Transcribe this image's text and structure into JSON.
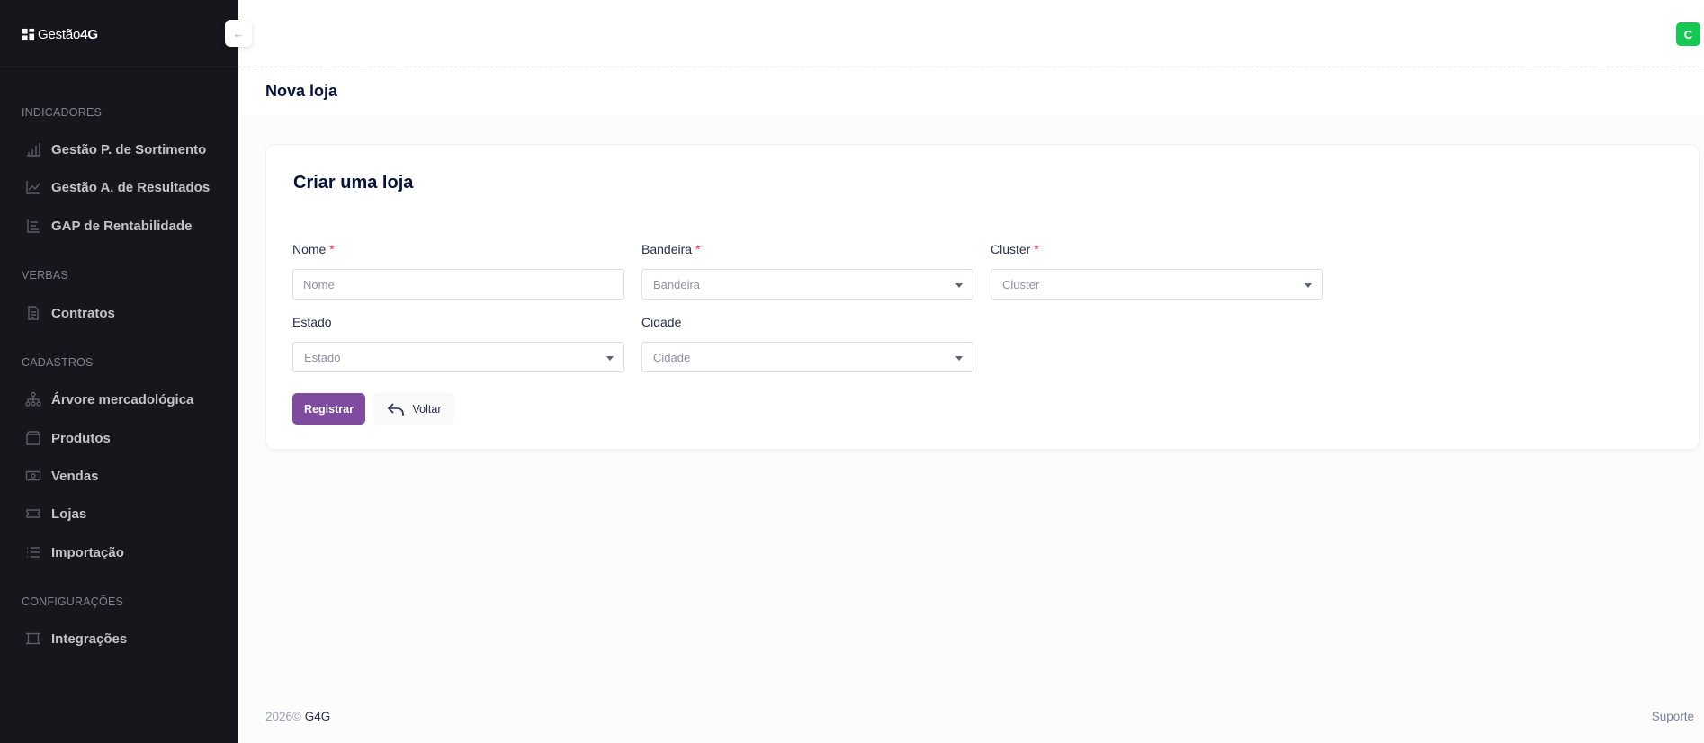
{
  "brand": {
    "name_prefix": "Gestão",
    "name_suffix": "4G"
  },
  "sidebar": {
    "collapse_icon": "arrow-left-icon",
    "sections": [
      {
        "title": "INDICADORES",
        "items": [
          {
            "label": "Gestão P. de Sortimento",
            "icon": "bar-chart-icon"
          },
          {
            "label": "Gestão A. de Resultados",
            "icon": "line-chart-icon"
          },
          {
            "label": "GAP de Rentabilidade",
            "icon": "list-tree-icon"
          }
        ]
      },
      {
        "title": "VERBAS",
        "items": [
          {
            "label": "Contratos",
            "icon": "document-icon"
          }
        ]
      },
      {
        "title": "CADASTROS",
        "items": [
          {
            "label": "Árvore mercadológica",
            "icon": "hierarchy-icon"
          },
          {
            "label": "Produtos",
            "icon": "box-icon"
          },
          {
            "label": "Vendas",
            "icon": "money-icon"
          },
          {
            "label": "Lojas",
            "icon": "ticket-icon"
          },
          {
            "label": "Importação",
            "icon": "list-icon"
          }
        ]
      },
      {
        "title": "CONFIGURAÇÕES",
        "items": [
          {
            "label": "Integrações",
            "icon": "frame-icon"
          }
        ]
      }
    ]
  },
  "header": {
    "avatar_letter": "C"
  },
  "toolbar": {
    "page_title": "Nova loja"
  },
  "form": {
    "title": "Criar uma loja",
    "fields": {
      "nome": {
        "label": "Nome",
        "required_mark": "*",
        "placeholder": "Nome",
        "value": ""
      },
      "bandeira": {
        "label": "Bandeira",
        "required_mark": "*",
        "placeholder": "Bandeira"
      },
      "cluster": {
        "label": "Cluster",
        "required_mark": "*",
        "placeholder": "Cluster"
      },
      "estado": {
        "label": "Estado",
        "placeholder": "Estado"
      },
      "cidade": {
        "label": "Cidade",
        "placeholder": "Cidade"
      }
    },
    "buttons": {
      "submit": "Registrar",
      "back": "Voltar"
    }
  },
  "footer": {
    "year": "2026©",
    "brand": "G4G",
    "support": "Suporte"
  },
  "colors": {
    "sidebar_bg": "#15171c",
    "primary": "#7e4b9e",
    "avatar": "#17c653",
    "required": "#f8285a"
  }
}
